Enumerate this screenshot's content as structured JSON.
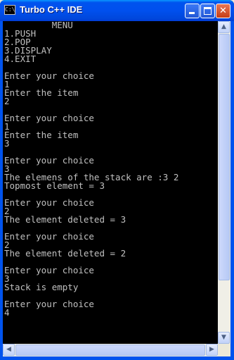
{
  "window": {
    "title": "Turbo C++ IDE",
    "icon_label": "C:\\",
    "buttons": {
      "minimize": "minimize",
      "maximize": "maximize",
      "close": "✕"
    }
  },
  "console": {
    "lines": [
      "         MENU",
      "1.PUSH",
      "2.POP",
      "3.DISPLAY",
      "4.EXIT",
      "",
      "Enter your choice",
      "1",
      "Enter the item",
      "2",
      "",
      "Enter your choice",
      "1",
      "Enter the item",
      "3",
      "",
      "Enter your choice",
      "3",
      "The elemens of the stack are :3 2",
      "Topmost element = 3",
      "",
      "Enter your choice",
      "2",
      "The element deleted = 3",
      "",
      "Enter your choice",
      "2",
      "The element deleted = 2",
      "",
      "Enter your choice",
      "3",
      "Stack is empty",
      "",
      "Enter your choice",
      "4"
    ],
    "text_color": "#c0c0c0",
    "background": "#000000"
  },
  "scrollbars": {
    "up_arrow": "▲",
    "down_arrow": "▼",
    "left_arrow": "◀",
    "right_arrow": "▶"
  }
}
